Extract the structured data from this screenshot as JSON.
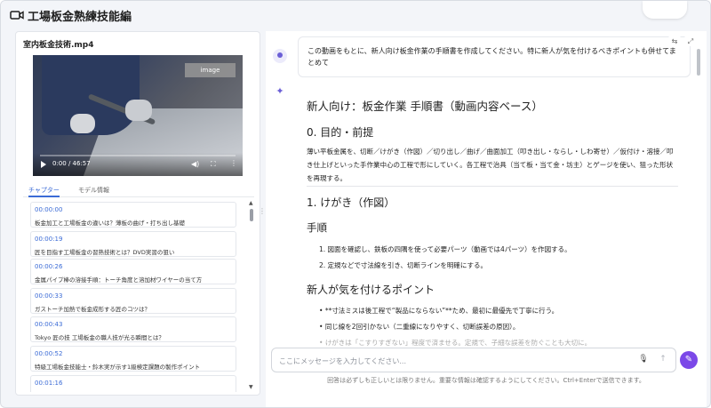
{
  "header": {
    "title": "工場板金熟練技能編",
    "icon": "video-camera-icon",
    "top_button": ""
  },
  "left": {
    "video_title": "室内板金技術.mp4",
    "video": {
      "image_tag": "image",
      "time": "0:00 / 46:57",
      "progress": 0.0
    },
    "tabs": [
      {
        "label": "チャプター",
        "active": true
      },
      {
        "label": "モデル情報",
        "active": false
      }
    ],
    "chapters": [
      {
        "time": "00:00:00",
        "desc": "板金加工と工場板金の違いは？薄板の曲げ・打ち出し基礎"
      },
      {
        "time": "00:00:19",
        "desc": "匠を目指す工場板金の習熟技術とは？DVD実習の狙い"
      },
      {
        "time": "00:00:26",
        "desc": "金属パイプ棒の溶接手順：トーチ角度と溶加材ワイヤーの当て方"
      },
      {
        "time": "00:00:33",
        "desc": "ガストーチ加熱で板金成形する匠のコツは？"
      },
      {
        "time": "00:00:43",
        "desc": "Tokyo 匠の技 工場板金の職人技が光る瞬間とは？"
      },
      {
        "time": "00:00:52",
        "desc": "特級工場板金技能士・鈴木実が示す1級検定課題の製作ポイント"
      },
      {
        "time": "00:01:16",
        "desc": ""
      }
    ]
  },
  "chat": {
    "user_message": "この動画をもとに、新人向け板金作業の手順書を作成してください。特に新人が気を付けるべきポイントも併せてまとめて",
    "answer": {
      "title": "新人向け：板金作業 手順書（動画内容ベース）",
      "sec0": "0. 目的・前提",
      "intro": "薄い平板金属を、切断／けがき（作図）／切り出し／曲げ／曲面加工（叩き出し・ならし・しわ寄せ）／仮付け・溶接／叩き仕上げといった手作業中心の工程で形にしていく。各工程で治具（当て板・当て金・坊主）とゲージを使い、狙った形状を再現する。",
      "sec1": "1. けがき（作図）",
      "procedure_heading": "手順",
      "steps": [
        "図面を確認し、鉄板の四隅を使って必要パーツ（動画では4パーツ）を作図する。",
        "定規などで寸法線を引き、切断ラインを明確にする。"
      ],
      "points_heading": "新人が気を付けるポイント",
      "points": [
        "**寸法ミスは後工程で“製品にならない”**ため、最初に最優先で丁寧に行う。",
        "同じ線を2回引かない（二重線になりやすく、切断誤差の原因）。",
        "けがきは「こすりすぎない」程度で済ませる。定規で、子細な誤差を防ぐことも大切に。"
      ]
    },
    "input_placeholder": "ここにメッセージを入力してください...",
    "disclaimer": "回答は必ずしも正しいとは限りません。重要な情報は確認するようにしてください。Ctrl+Enterで送信できます。"
  },
  "colors": {
    "accent": "#3b6bd6",
    "magic": "#7b48e8",
    "ai_icon": "#6b5fd6"
  }
}
